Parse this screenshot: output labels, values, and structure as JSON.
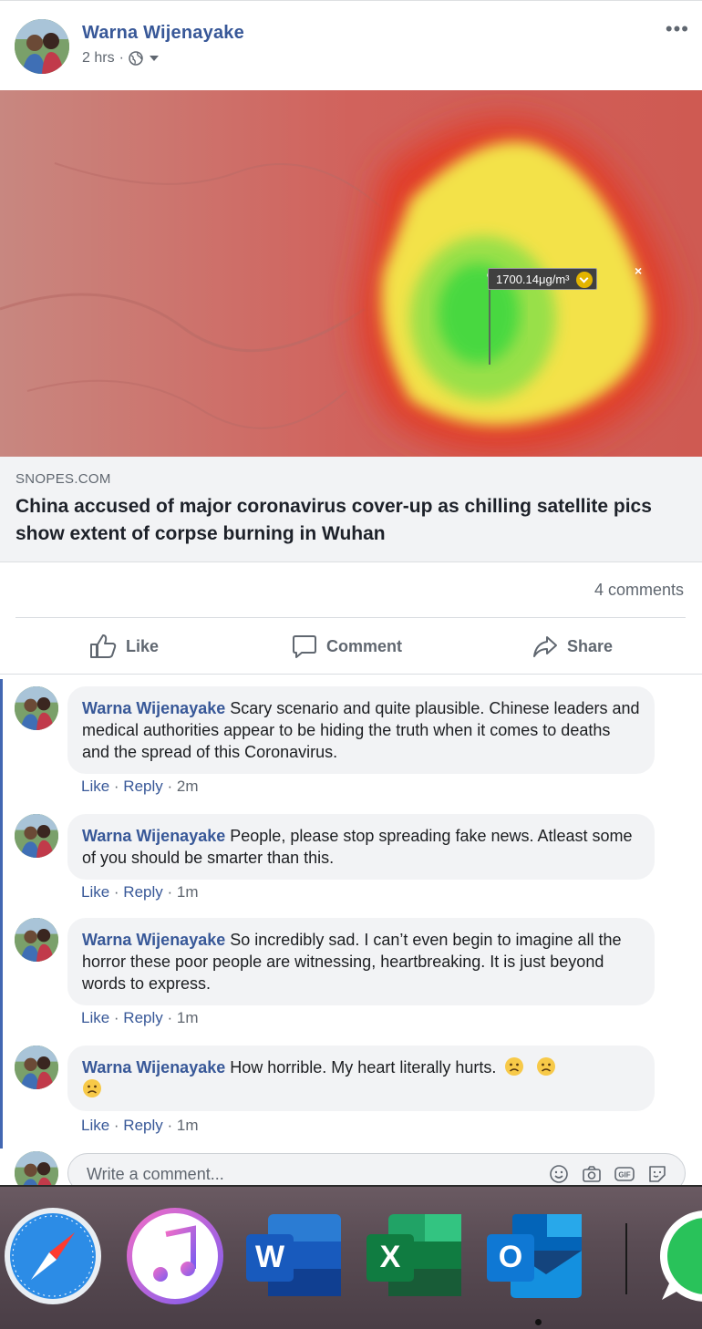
{
  "post": {
    "author": "Warna Wijenayake",
    "time": "2 hrs",
    "separator": "·",
    "more_label": "•••"
  },
  "link": {
    "tooltip_value": "1700.14μg/m³",
    "tooltip_close": "×",
    "domain": "SNOPES.COM",
    "title": "China accused of major coronavirus cover-up as chilling satellite pics show extent of corpse burning in Wuhan"
  },
  "stats": {
    "comments_count": "4 comments"
  },
  "actions": {
    "like": "Like",
    "comment": "Comment",
    "share": "Share"
  },
  "comments": [
    {
      "author": "Warna Wijenayake",
      "text": "Scary scenario and quite plausible. Chinese leaders and medical authorities appear to be hiding the truth when it comes to deaths and the spread of this Coronavirus.",
      "like": "Like",
      "reply": "Reply",
      "time": "2m"
    },
    {
      "author": "Warna Wijenayake",
      "text": "People, please stop spreading fake news. Atleast some of you should be smarter than this.",
      "like": "Like",
      "reply": "Reply",
      "time": "1m"
    },
    {
      "author": "Warna Wijenayake",
      "text": "So incredibly sad. I can’t even begin to imagine all the horror these poor people are witnessing, heartbreaking. It is just beyond words to express.",
      "like": "Like",
      "reply": "Reply",
      "time": "1m"
    },
    {
      "author": "Warna Wijenayake",
      "text": "How horrible. My heart literally hurts.",
      "like": "Like",
      "reply": "Reply",
      "time": "1m"
    }
  ],
  "composer": {
    "placeholder": "Write a comment...",
    "gif_label": "GIF"
  },
  "dock": {
    "apps": [
      "safari-icon",
      "itunes-icon",
      "word-icon",
      "excel-icon",
      "outlook-icon",
      "whatsapp-icon"
    ],
    "word_letter": "W",
    "excel_letter": "X",
    "outlook_letter": "O"
  },
  "colors": {
    "link_blue": "#385898",
    "facebook_blue": "#4267b2",
    "muted": "#606770",
    "bubble": "#f2f3f5"
  }
}
